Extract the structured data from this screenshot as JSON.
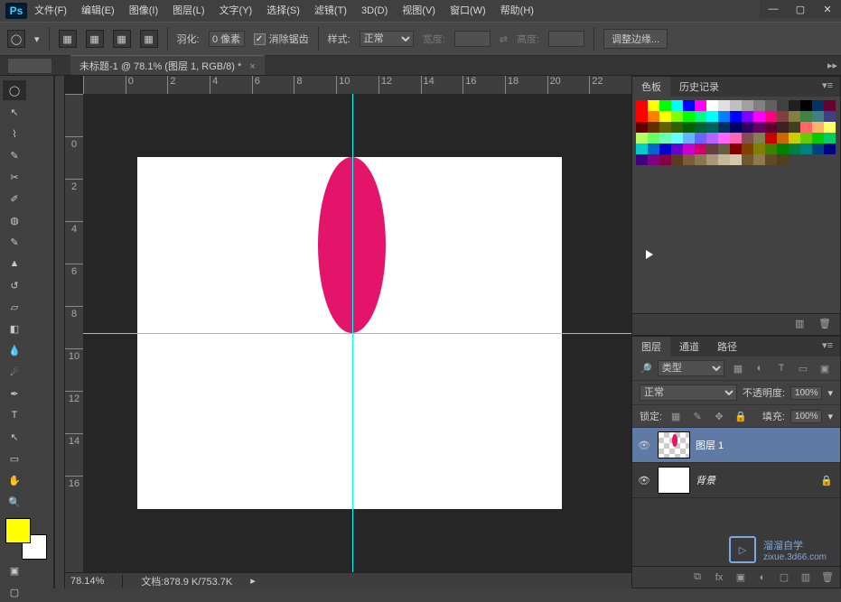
{
  "app": {
    "logo": "Ps"
  },
  "menu": [
    "文件(F)",
    "编辑(E)",
    "图像(I)",
    "图层(L)",
    "文字(Y)",
    "选择(S)",
    "滤镜(T)",
    "3D(D)",
    "视图(V)",
    "窗口(W)",
    "帮助(H)"
  ],
  "winbtns": {
    "min": "—",
    "max": "▢",
    "close": "✕"
  },
  "options": {
    "feather_lbl": "羽化:",
    "feather_val": "0 像素",
    "antialias": "消除锯齿",
    "style_lbl": "样式:",
    "style_val": "正常",
    "width_lbl": "宽度:",
    "height_lbl": "高度:",
    "refine": "调整边缘..."
  },
  "tab": {
    "title": "未标题-1 @ 78.1% (图层 1, RGB/8) *"
  },
  "ruler_h": [
    "",
    "0",
    "2",
    "4",
    "6",
    "8",
    "10",
    "12",
    "14",
    "16",
    "18",
    "20",
    "22"
  ],
  "ruler_v": [
    "",
    "0",
    "2",
    "4",
    "6",
    "8",
    "10",
    "12",
    "14",
    "16"
  ],
  "status": {
    "zoom": "78.14%",
    "docinfo": "文档:878.9 K/753.7K"
  },
  "swatch_tabs": [
    "色板",
    "历史记录"
  ],
  "swatch_colors": [
    "#ff0000",
    "#ffff00",
    "#00ff00",
    "#00ffff",
    "#0000ff",
    "#ff00ff",
    "#ffffff",
    "#e0e0e0",
    "#c0c0c0",
    "#a0a0a0",
    "#808080",
    "#606060",
    "#404040",
    "#202020",
    "#000000",
    "#003366",
    "#660033",
    "#ff0000",
    "#ff8000",
    "#ffff00",
    "#80ff00",
    "#00ff00",
    "#00ff80",
    "#00ffff",
    "#0080ff",
    "#0000ff",
    "#8000ff",
    "#ff00ff",
    "#ff0080",
    "#804040",
    "#808040",
    "#408040",
    "#408080",
    "#404080",
    "#600000",
    "#603000",
    "#606000",
    "#306000",
    "#006000",
    "#006030",
    "#006060",
    "#003060",
    "#000060",
    "#300060",
    "#600060",
    "#600030",
    "#402020",
    "#404020",
    "#ff6666",
    "#ffb366",
    "#ffff66",
    "#b3ff66",
    "#66ff66",
    "#66ffb3",
    "#66ffff",
    "#66b3ff",
    "#6666ff",
    "#b366ff",
    "#ff66ff",
    "#ff66b3",
    "#805050",
    "#808050",
    "#cc0000",
    "#cc6600",
    "#cccc00",
    "#66cc00",
    "#00cc00",
    "#00cc66",
    "#00cccc",
    "#0066cc",
    "#0000cc",
    "#6600cc",
    "#cc00cc",
    "#cc0066",
    "#604040",
    "#606040",
    "#800000",
    "#804000",
    "#808000",
    "#408000",
    "#008000",
    "#008040",
    "#008080",
    "#004080",
    "#000080",
    "#400080",
    "#800080",
    "#800040",
    "#5b3a1e",
    "#7b5a3e",
    "#8a7654",
    "#a89878",
    "#c6b89c",
    "#d5c8ac",
    "#705830",
    "#907850",
    "#604828",
    "#504020"
  ],
  "layer_tabs": [
    "图层",
    "通道",
    "路径"
  ],
  "layer_opts": {
    "kind": "类型",
    "blend": "正常",
    "opacity_lbl": "不透明度:",
    "opacity_val": "100%",
    "lock_lbl": "锁定:",
    "fill_lbl": "填充:",
    "fill_val": "100%"
  },
  "layers": [
    {
      "name": "图层 1",
      "selected": true,
      "hasShape": true
    },
    {
      "name": "背景",
      "selected": false,
      "locked": true,
      "bg": true,
      "italic": true
    }
  ],
  "watermark": {
    "text": "溜溜自学",
    "url": "zixue.3d66.com"
  }
}
